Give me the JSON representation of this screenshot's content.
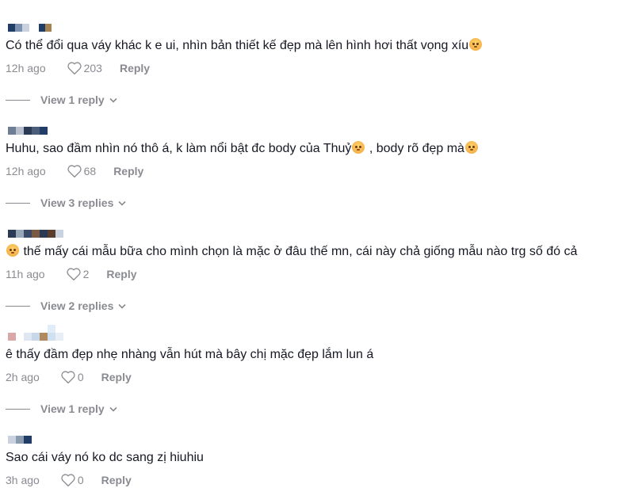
{
  "comments": [
    {
      "text_before": "Có thể đổi qua váy khác k e ui, nhìn bản thiết kế đẹp mà lên hình hơi thất vọng xíu",
      "text_after": "",
      "time": "12h ago",
      "likes": "203",
      "reply_label": "Reply",
      "view_replies": "View 1 reply"
    },
    {
      "text_before": "Huhu, sao đầm nhìn nó thô á, k làm nổi bật đc body của Thuỷ",
      "text_after": " , body rõ đẹp mà",
      "time": "12h ago",
      "likes": "68",
      "reply_label": "Reply",
      "view_replies": "View 3 replies"
    },
    {
      "text_before": "",
      "text_after": " thế mấy cái mẫu bữa cho mình chọn là mặc ở đâu thế mn, cái này chả giống mẫu nào trg số đó cả",
      "time": "11h ago",
      "likes": "2",
      "reply_label": "Reply",
      "view_replies": "View 2 replies"
    },
    {
      "text_before": "ê thấy đầm đẹp nhẹ nhàng vẫn hút mà bây chị mặc đẹp lắm lun á",
      "text_after": "",
      "time": "2h ago",
      "likes": "0",
      "reply_label": "Reply",
      "view_replies": "View 1 reply"
    },
    {
      "text_before": "Sao cái váy nó ko dc sang zị hiuhiu",
      "text_after": "",
      "time": "3h ago",
      "likes": "0",
      "reply_label": "Reply",
      "view_replies": ""
    }
  ],
  "colors": {
    "text": "#161823",
    "muted": "#8a8b91",
    "background": "#ffffff",
    "emoji": "#f2a33a"
  },
  "icons": [
    "heart-icon",
    "chevron-down-icon",
    "pleading-face-emoji"
  ]
}
